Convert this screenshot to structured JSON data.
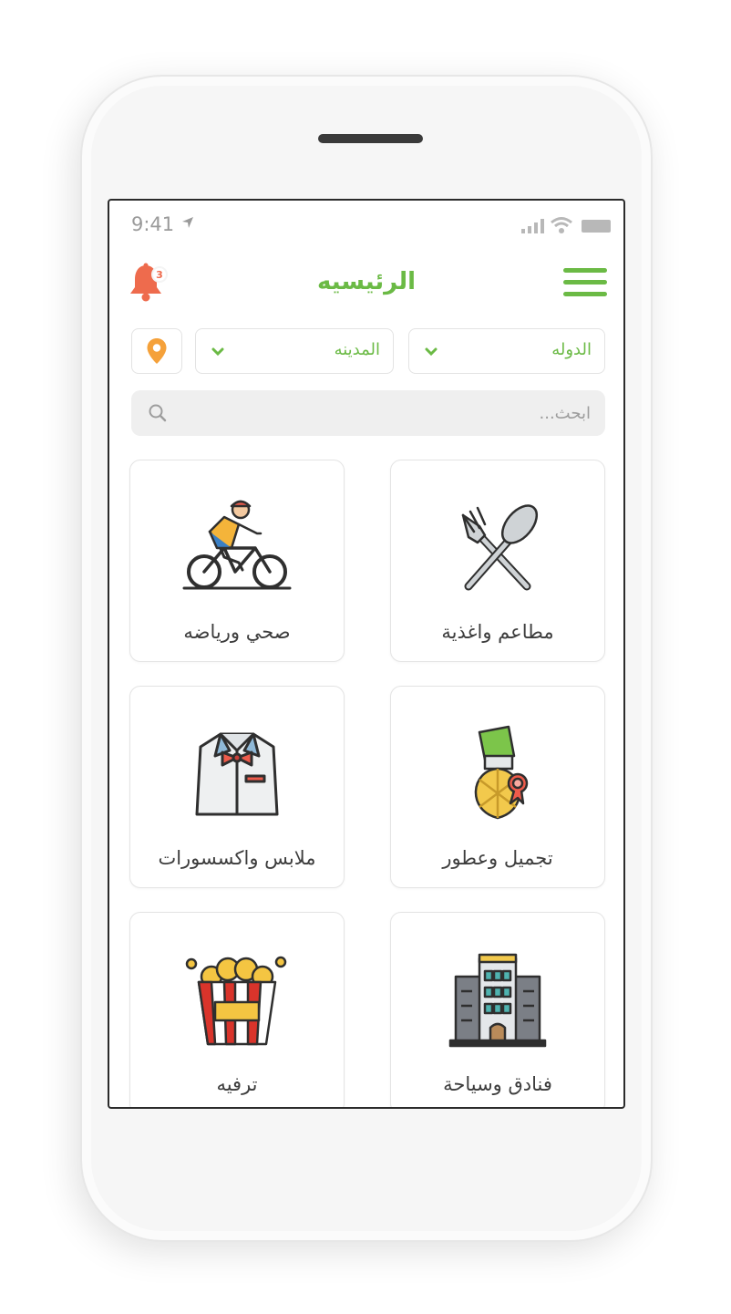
{
  "status_bar": {
    "time": "9:41"
  },
  "header": {
    "title": "الرئيسيه",
    "notification_count": "3"
  },
  "filters": {
    "country_label": "الدوله",
    "city_label": "المدينه"
  },
  "search": {
    "placeholder": "ابحث..."
  },
  "categories": [
    {
      "label": "مطاعم واغذية",
      "icon": "fork-spoon-icon"
    },
    {
      "label": "صحي ورياضه",
      "icon": "cyclist-icon"
    },
    {
      "label": "تجميل وعطور",
      "icon": "perfume-icon"
    },
    {
      "label": "ملابس واكسسورات",
      "icon": "shirt-bowtie-icon"
    },
    {
      "label": "فنادق وسياحة",
      "icon": "hotel-icon"
    },
    {
      "label": "ترفيه",
      "icon": "popcorn-icon"
    }
  ],
  "colors": {
    "accent": "#6bba45",
    "bell": "#ee6b4d",
    "location_pin": "#f5a13a"
  }
}
